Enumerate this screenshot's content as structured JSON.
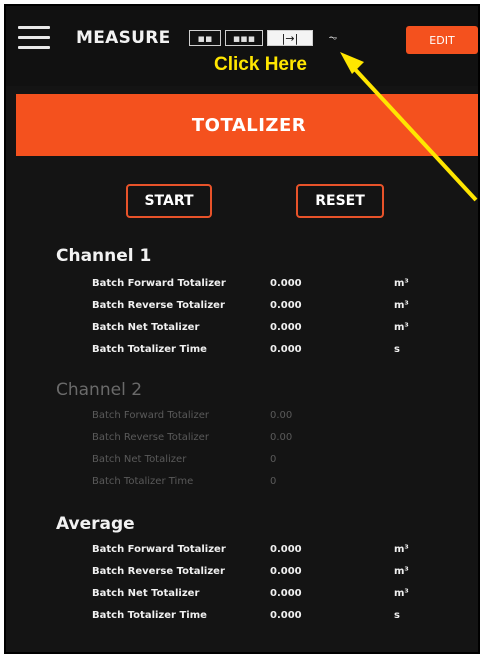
{
  "header": {
    "title": "MEASURE",
    "view_tabs": [
      {
        "icon": "grid-view-icon",
        "glyph": "▪▪"
      },
      {
        "icon": "split-view-icon",
        "glyph": "▪▪▪"
      },
      {
        "icon": "totalizer-view-icon",
        "glyph": "|→|"
      },
      {
        "icon": "graph-view-icon",
        "glyph": "⏦"
      }
    ],
    "edit_label": "EDIT"
  },
  "annotation": {
    "text": "Click Here",
    "color": "#ffe600"
  },
  "section": {
    "title": "TOTALIZER"
  },
  "buttons": {
    "start": "START",
    "reset": "RESET"
  },
  "channel1": {
    "title": "Channel 1",
    "rows": [
      {
        "label": "Batch Forward Totalizer",
        "value": "0.000",
        "unit": "m³"
      },
      {
        "label": "Batch Reverse Totalizer",
        "value": "0.000",
        "unit": "m³"
      },
      {
        "label": "Batch Net Totalizer",
        "value": "0.000",
        "unit": "m³"
      },
      {
        "label": "Batch Totalizer Time",
        "value": "0.000",
        "unit": "s"
      }
    ]
  },
  "channel2": {
    "title": "Channel 2",
    "rows": [
      {
        "label": "Batch Forward Totalizer",
        "value": "0.00",
        "unit": ""
      },
      {
        "label": "Batch Reverse Totalizer",
        "value": "0.00",
        "unit": ""
      },
      {
        "label": "Batch Net Totalizer",
        "value": "0",
        "unit": ""
      },
      {
        "label": "Batch Totalizer Time",
        "value": "0",
        "unit": ""
      }
    ]
  },
  "average": {
    "title": "Average",
    "rows": [
      {
        "label": "Batch Forward Totalizer",
        "value": "0.000",
        "unit": "m³"
      },
      {
        "label": "Batch Reverse Totalizer",
        "value": "0.000",
        "unit": "m³"
      },
      {
        "label": "Batch Net Totalizer",
        "value": "0.000",
        "unit": "m³"
      },
      {
        "label": "Batch Totalizer Time",
        "value": "0.000",
        "unit": "s"
      }
    ]
  },
  "colors": {
    "accent": "#f4511e",
    "background": "#141414"
  }
}
